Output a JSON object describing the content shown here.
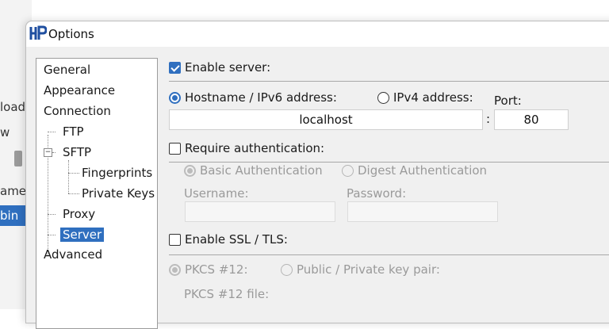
{
  "background_app": {
    "labels": [
      "load",
      "w",
      "ame"
    ],
    "selected_item": "bin"
  },
  "dialog": {
    "title": "Options"
  },
  "tree": {
    "items": [
      {
        "label": "General"
      },
      {
        "label": "Appearance"
      },
      {
        "label": "Connection"
      },
      {
        "label": "FTP"
      },
      {
        "label": "SFTP"
      },
      {
        "label": "Fingerprints"
      },
      {
        "label": "Private Keys"
      },
      {
        "label": "Proxy"
      },
      {
        "label": "Server",
        "selected": true
      },
      {
        "label": "Advanced"
      }
    ]
  },
  "server": {
    "enable_server_label": "Enable server:",
    "enable_server_checked": true,
    "hostname_label": "Hostname / IPv6 address:",
    "hostname_selected": true,
    "ipv4_label": "IPv4 address:",
    "port_label": "Port:",
    "hostname_value": "localhost",
    "colon": ":",
    "port_value": "80",
    "require_auth_label": "Require authentication:",
    "require_auth_checked": false,
    "basic_auth_label": "Basic Authentication",
    "digest_auth_label": "Digest Authentication",
    "username_label": "Username:",
    "password_label": "Password:",
    "username_value": "",
    "password_value": "",
    "ssl_label": "Enable SSL / TLS:",
    "ssl_checked": false,
    "pkcs12_label": "PKCS #12:",
    "keypair_label": "Public / Private key pair:",
    "pkcs12_file_label": "PKCS #12 file:"
  },
  "colors": {
    "accent": "#2f6fbf",
    "dialog_bg": "#f0f0f0",
    "disabled_text": "#9a9a9a"
  }
}
